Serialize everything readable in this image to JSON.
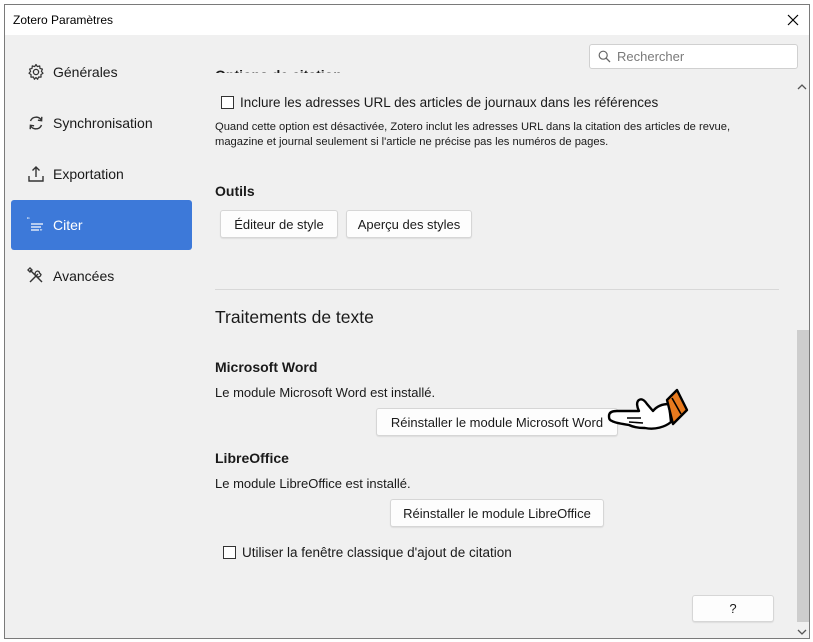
{
  "window": {
    "title": "Zotero Paramètres"
  },
  "sidebar": {
    "items": [
      {
        "label": "Générales",
        "icon": "gear-icon"
      },
      {
        "label": "Synchronisation",
        "icon": "sync-icon"
      },
      {
        "label": "Exportation",
        "icon": "export-icon"
      },
      {
        "label": "Citer",
        "icon": "cite-icon",
        "active": true
      },
      {
        "label": "Avancées",
        "icon": "tools-icon"
      }
    ]
  },
  "search": {
    "placeholder": "Rechercher"
  },
  "citation_options": {
    "heading": "Options de citation",
    "include_urls_label": "Inclure les adresses URL des articles de journaux dans les références",
    "include_urls_checked": false,
    "note": "Quand cette option est désactivée, Zotero inclut les adresses URL dans la citation des articles de revue, magazine et journal seulement si l'article ne précise pas les numéros de pages."
  },
  "tools": {
    "heading": "Outils",
    "style_editor_label": "Éditeur de style",
    "style_preview_label": "Aperçu des styles"
  },
  "word_processors": {
    "title": "Traitements de texte",
    "word": {
      "heading": "Microsoft Word",
      "status": "Le module Microsoft Word est installé.",
      "reinstall_label": "Réinstaller le module Microsoft Word"
    },
    "libreoffice": {
      "heading": "LibreOffice",
      "status": "Le module LibreOffice est installé.",
      "reinstall_label": "Réinstaller le module LibreOffice"
    },
    "classic_dialog_label": "Utiliser la fenêtre classique d'ajout de citation",
    "classic_dialog_checked": false
  },
  "help_button": {
    "label": "?"
  },
  "colors": {
    "accent": "#3d79d9",
    "background": "#f0f0f0",
    "hand_cuff": "#e87a1e"
  }
}
